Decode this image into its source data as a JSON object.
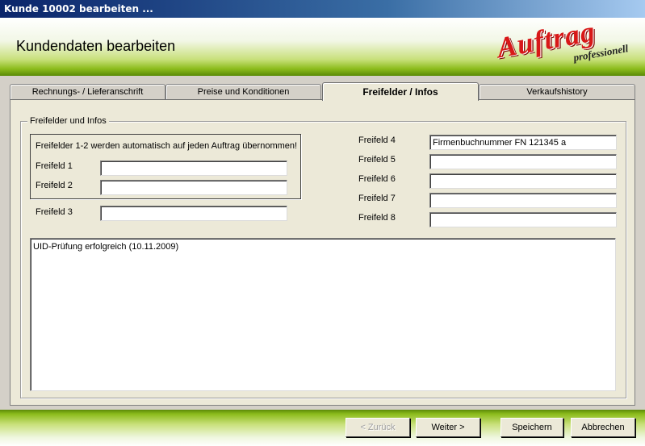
{
  "window": {
    "title": "Kunde 10002 bearbeiten ..."
  },
  "header": {
    "title": "Kundendaten bearbeiten",
    "logo_main": "Auftrag",
    "logo_sub": "professionell"
  },
  "tabs": [
    {
      "label": "Rechnungs- /  Lieferanschrift",
      "active": false
    },
    {
      "label": "Preise und Konditionen",
      "active": false
    },
    {
      "label": "Freifelder / Infos",
      "active": true
    },
    {
      "label": "Verkaufshistory",
      "active": false
    }
  ],
  "panel": {
    "group_title": "Freifelder und Infos",
    "note": "Freifelder 1-2 werden automatisch auf jeden Auftrag übernommen!",
    "fields": [
      {
        "label": "Freifeld 1",
        "value": ""
      },
      {
        "label": "Freifeld 2",
        "value": ""
      },
      {
        "label": "Freifeld 3",
        "value": ""
      },
      {
        "label": "Freifeld 4",
        "value": "Firmenbuchnummer FN 121345 a"
      },
      {
        "label": "Freifeld 5",
        "value": ""
      },
      {
        "label": "Freifeld 6",
        "value": ""
      },
      {
        "label": "Freifeld 7",
        "value": ""
      },
      {
        "label": "Freifeld 8",
        "value": ""
      }
    ],
    "memo": "UID-Prüfung erfolgreich (10.11.2009)"
  },
  "footer": {
    "back_label": "< Zurück",
    "next_label": "Weiter >",
    "save_label": "Speichern",
    "cancel_label": "Abbrechen"
  },
  "colors": {
    "accent_green": "#8cbc1c",
    "logo_red": "#d81818",
    "titlebar_blue": "#0a246a"
  }
}
